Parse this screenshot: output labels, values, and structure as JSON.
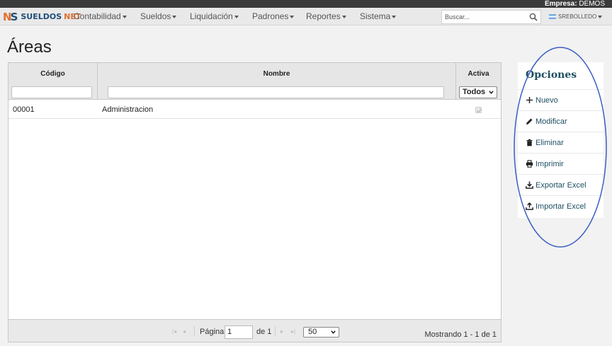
{
  "topbar": {
    "company_label": "Empresa:",
    "company_value": "DEMOS"
  },
  "brand": {
    "logo_text": "SUELDOS",
    "logo_text2": "NET"
  },
  "nav": {
    "items": [
      "Contabilidad",
      "Sueldos",
      "Liquidación",
      "Padrones",
      "Reportes",
      "Sistema"
    ]
  },
  "search": {
    "placeholder": "Buscar..."
  },
  "user": {
    "name": "SREBOLLEDO"
  },
  "page": {
    "title": "Áreas"
  },
  "grid": {
    "columns": [
      "Código",
      "Nombre",
      "Activa"
    ],
    "filter_select": "Todos",
    "rows": [
      {
        "codigo": "00001",
        "nombre": "Administracion",
        "activa": true
      }
    ]
  },
  "pager": {
    "page_label": "Página",
    "page_value": "1",
    "of_label": "de 1",
    "page_size": "50",
    "status": "Mostrando 1 - 1 de 1"
  },
  "options": {
    "title": "Opciones",
    "items": [
      {
        "label": "Nuevo",
        "icon": "plus-icon"
      },
      {
        "label": "Modificar",
        "icon": "pencil-icon"
      },
      {
        "label": "Eliminar",
        "icon": "trash-icon"
      },
      {
        "label": "Imprimir",
        "icon": "printer-icon"
      },
      {
        "label": "Exportar Excel",
        "icon": "download-icon"
      },
      {
        "label": "Importar Excel",
        "icon": "upload-icon"
      }
    ]
  },
  "colors": {
    "accent": "#1e4f63",
    "brand_blue": "#1f4e79",
    "brand_orange": "#e07030",
    "annotation": "#3a5fc4"
  }
}
